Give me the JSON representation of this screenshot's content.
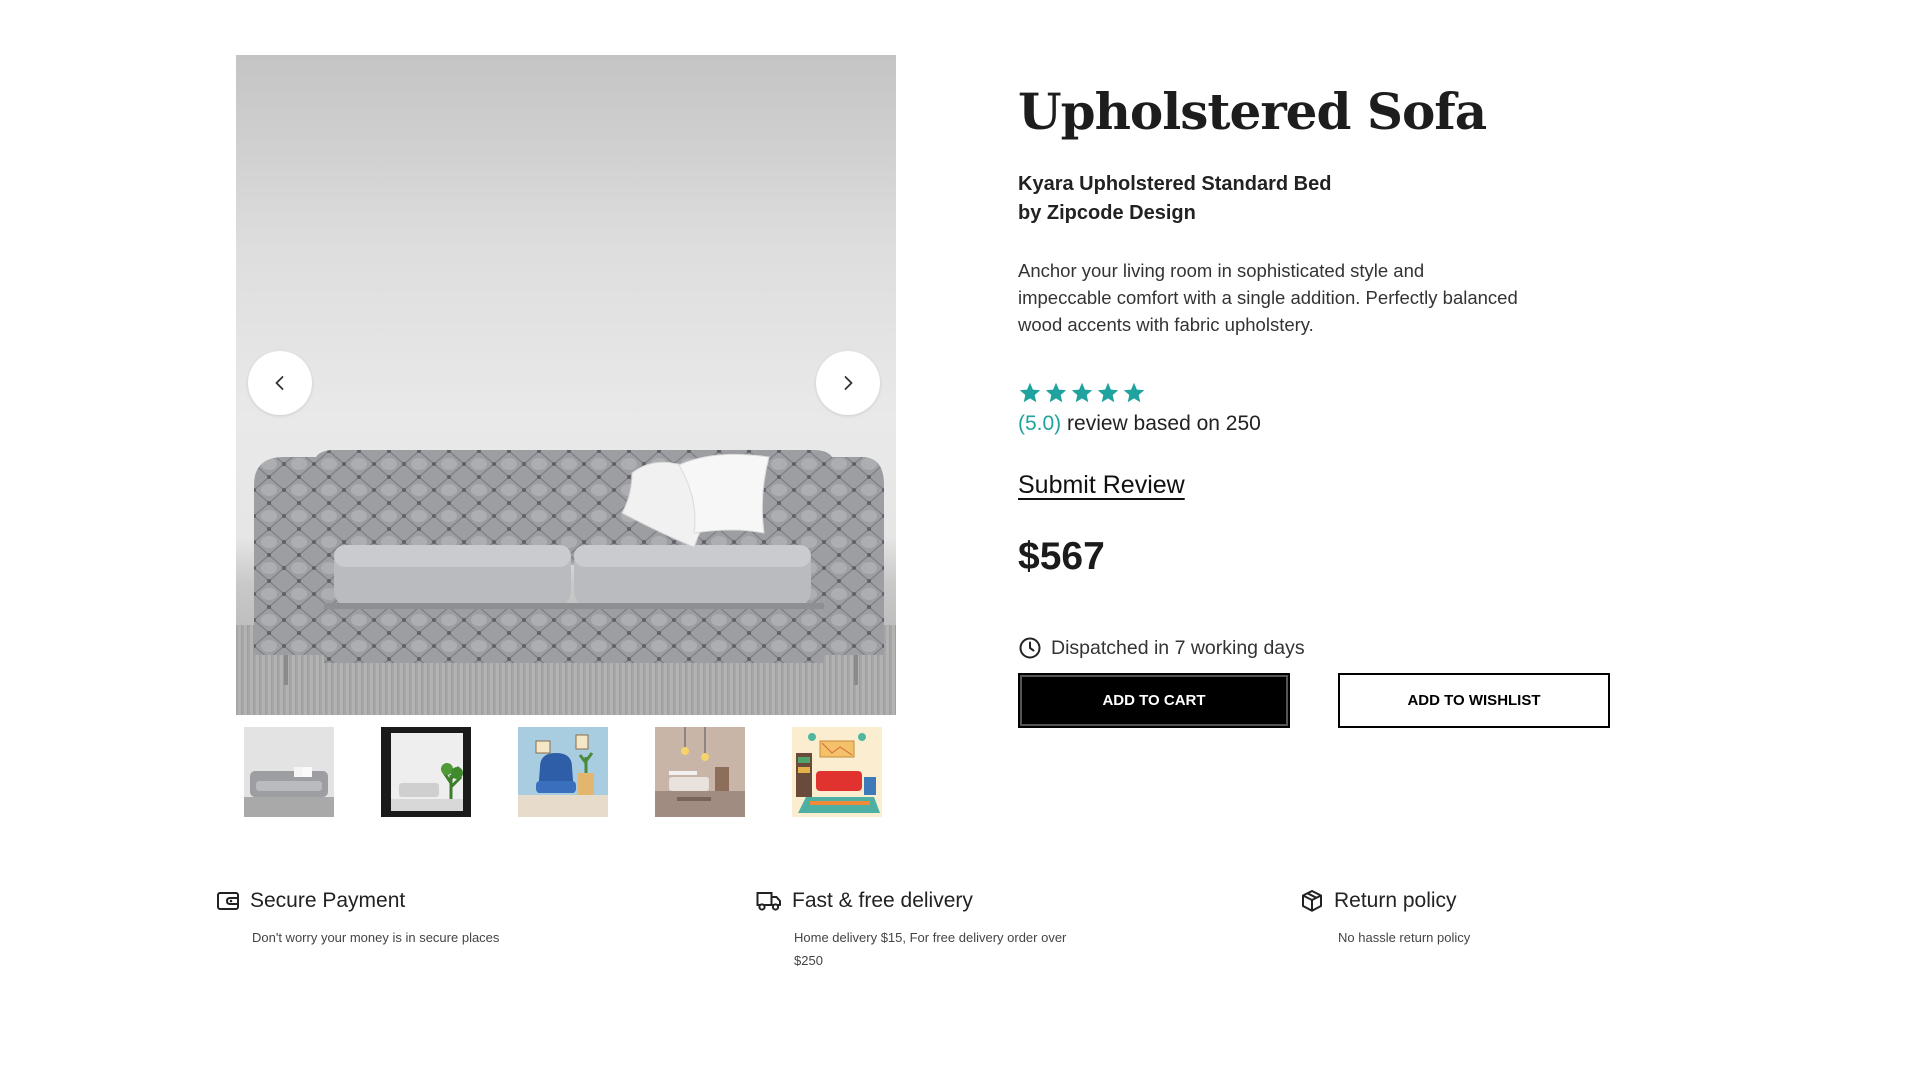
{
  "product": {
    "title": "Upholstered Sofa",
    "subtitle_line1": "Kyara Upholstered Standard Bed",
    "subtitle_line2": "by Zipcode Design",
    "description": "Anchor your living room in sophisticated style and impeccable comfort with a single addition. Perfectly balanced wood accents with fabric upholstery.",
    "rating": {
      "stars": 5,
      "score_text": "(5.0)",
      "review_text": " review based on 250"
    },
    "submit_review_label": "Submit Review",
    "price": "$567",
    "dispatch_text": "Dispatched in 7 working days",
    "add_to_cart_label": "ADD TO CART",
    "add_to_wishlist_label": "ADD TO WISHLIST"
  },
  "gallery": {
    "prev_icon": "chevron-left-icon",
    "next_icon": "chevron-right-icon",
    "thumbnail_count": 5
  },
  "features": [
    {
      "icon": "wallet-icon",
      "title": "Secure Payment",
      "text": "Don't worry your money is in secure places"
    },
    {
      "icon": "truck-icon",
      "title": "Fast & free delivery",
      "text": "Home delivery $15, For free delivery order over $250"
    },
    {
      "icon": "box-icon",
      "title": "Return policy",
      "text": "No hassle return policy"
    }
  ],
  "colors": {
    "accent": "#20a39e",
    "primary_button": "#000000",
    "text": "#1f1f1f"
  }
}
